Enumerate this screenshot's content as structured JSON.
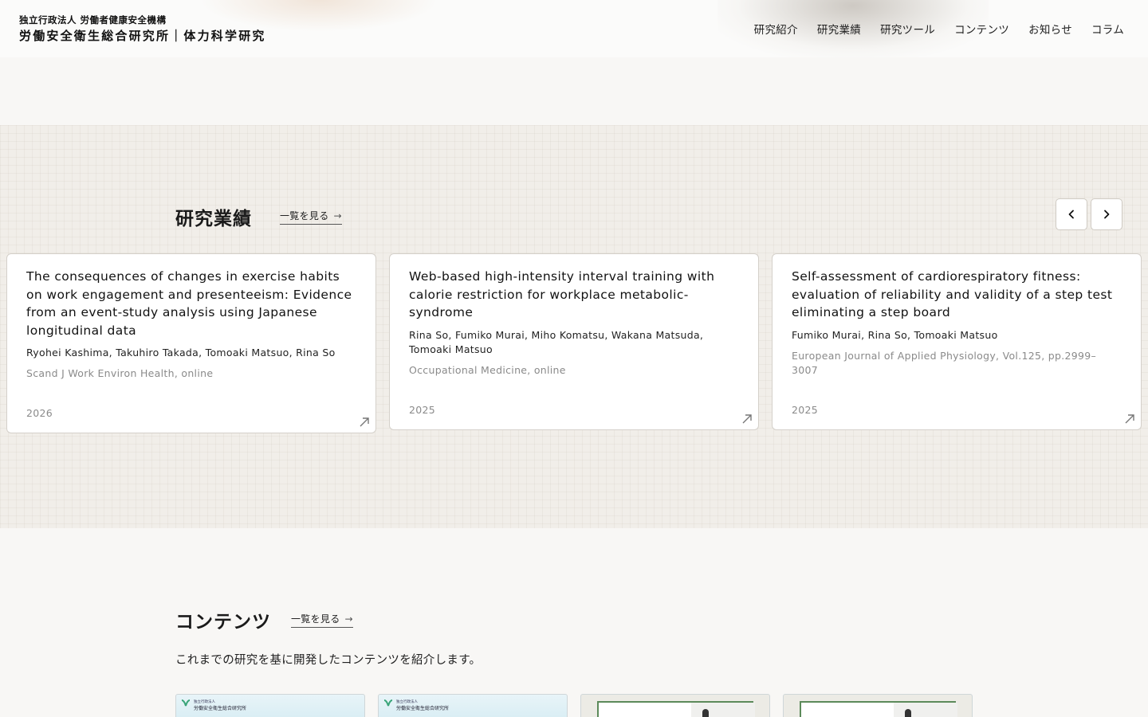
{
  "header": {
    "org_sub": "独立行政法人 労働者健康安全機構",
    "org_main": "労働安全衛生総合研究所｜体力科学研究",
    "nav": [
      "研究紹介",
      "研究業績",
      "研究ツール",
      "コンテンツ",
      "お知らせ",
      "コラム"
    ]
  },
  "results": {
    "title": "研究業績",
    "more_label": "一覧を見る",
    "more_arrow": "→",
    "prev_icon": "chevron-left-icon",
    "next_icon": "chevron-right-icon",
    "cards": [
      {
        "title": "The consequences of changes in exercise habits on work engagement and presenteeism: Evidence from an event-study analysis using Japanese longitudinal data",
        "authors": "Ryohei Kashima, Takuhiro Takada, Tomoaki Matsuo, Rina So",
        "journal": "Scand J Work Environ Health, online",
        "year": "2026"
      },
      {
        "title": "Web-based high-intensity interval training with calorie restriction for workplace metabolic-syndrome",
        "authors": "Rina So, Fumiko Murai, Miho Komatsu, Wakana Matsuda, Tomoaki Matsuo",
        "journal": "Occupational Medicine, online",
        "year": "2025"
      },
      {
        "title": "Self-assessment of cardiorespiratory fitness: evaluation of reliability and validity of a step test eliminating a step board",
        "authors": "Fumiko Murai, Rina So, Tomoaki Matsuo",
        "journal": "European Journal of Applied Physiology, Vol.125, pp.2999–3007",
        "year": "2025"
      }
    ]
  },
  "contents": {
    "title": "コンテンツ",
    "more_label": "一覧を見る",
    "more_arrow": "→",
    "description": "これまでの研究を基に開発したコンテンツを紹介します。",
    "thumbs": [
      {
        "mini_sub": "独立行政法人",
        "mini_title": "労働安全衛生総合研究所"
      },
      {
        "mini_sub": "独立行政法人",
        "mini_title": "労働安全衛生総合研究所"
      },
      {},
      {}
    ]
  },
  "colors": {
    "page_bg": "#f8f7f5",
    "section_bg": "#f1eee9",
    "card_border": "#d4d0ca",
    "muted_text": "#8a8a8a"
  }
}
